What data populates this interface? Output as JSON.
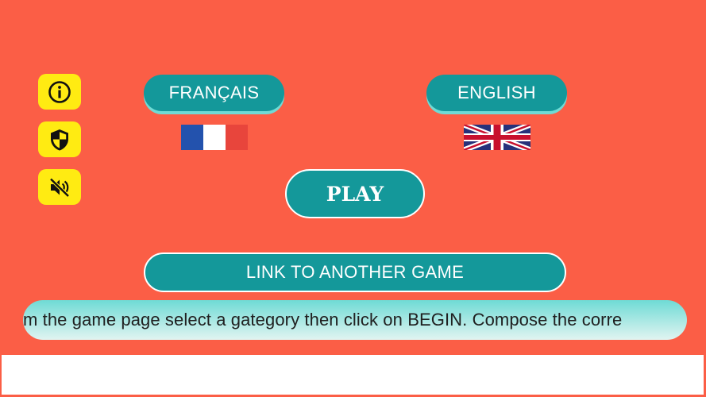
{
  "colors": {
    "background": "#fb5e46",
    "accent": "#14989a",
    "icon_button": "#ffeb12",
    "ticker_top": "#6fdbd5",
    "ticker_bottom": "#e1f4f1"
  },
  "side_buttons": [
    {
      "icon": "info-icon"
    },
    {
      "icon": "shield-icon"
    },
    {
      "icon": "volume-muted-icon"
    }
  ],
  "languages": {
    "french": {
      "label": "FRANÇAIS",
      "flag": "flag-france-icon"
    },
    "english": {
      "label": "ENGLISH",
      "flag": "flag-uk-icon"
    }
  },
  "play_label": "PLAY",
  "link_label": "LINK TO ANOTHER GAME",
  "ticker_text": "m the game page select a gategory then click on BEGIN. Compose the corre"
}
